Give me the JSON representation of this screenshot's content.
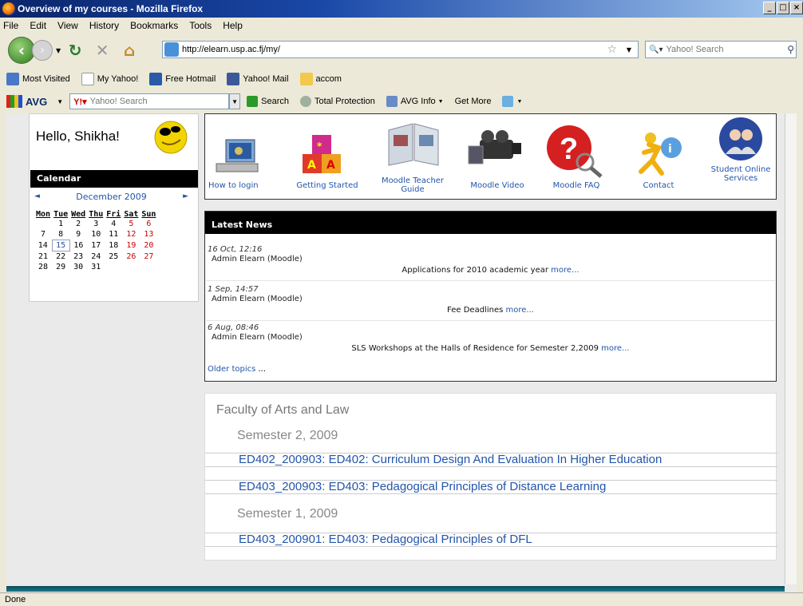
{
  "window": {
    "title": "Overview of my courses - Mozilla Firefox",
    "minimize": "_",
    "restore": "□",
    "close": "×"
  },
  "menu": [
    "File",
    "Edit",
    "View",
    "History",
    "Bookmarks",
    "Tools",
    "Help"
  ],
  "nav": {
    "url": "http://elearn.usp.ac.fj/my/",
    "search_placeholder": "Yahoo! Search"
  },
  "bookmarks": [
    "Most Visited",
    "My Yahoo!",
    "Free Hotmail",
    "Yahoo! Mail",
    "accom"
  ],
  "avg": {
    "logo": "AVG",
    "search_placeholder": "Yahoo! Search",
    "items": [
      "Search",
      "Total Protection",
      "AVG Info",
      "Get More"
    ]
  },
  "greeting": "Hello, Shikha!",
  "calendar": {
    "title": "Calendar",
    "month": "December 2009",
    "prev": "◄",
    "next": "►",
    "days": [
      "Mon",
      "Tue",
      "Wed",
      "Thu",
      "Fri",
      "Sat",
      "Sun"
    ],
    "weeks": [
      [
        "",
        "1",
        "2",
        "3",
        "4",
        "5",
        "6"
      ],
      [
        "7",
        "8",
        "9",
        "10",
        "11",
        "12",
        "13"
      ],
      [
        "14",
        "15",
        "16",
        "17",
        "18",
        "19",
        "20"
      ],
      [
        "21",
        "22",
        "23",
        "24",
        "25",
        "26",
        "27"
      ],
      [
        "28",
        "29",
        "30",
        "31",
        "",
        "",
        ""
      ]
    ]
  },
  "links": [
    {
      "label": "How to login"
    },
    {
      "label": "Getting Started"
    },
    {
      "label": "Moodle Teacher Guide"
    },
    {
      "label": "Moodle Video"
    },
    {
      "label": "Moodle FAQ"
    },
    {
      "label": "Contact"
    },
    {
      "label": "Student Online Services"
    }
  ],
  "news": {
    "title": "Latest News",
    "items": [
      {
        "date": "16 Oct, 12:16",
        "author": "Admin Elearn (Moodle)",
        "subject": "Applications for 2010 academic year",
        "more": "more..."
      },
      {
        "date": "1 Sep, 14:57",
        "author": "Admin Elearn (Moodle)",
        "subject": "Fee Deadlines",
        "more": "more..."
      },
      {
        "date": "6 Aug, 08:46",
        "author": "Admin Elearn (Moodle)",
        "subject": "SLS Workshops at the Halls of Residence for Semester 2,2009",
        "more": "more..."
      }
    ],
    "older": "Older topics",
    "older_suffix": "..."
  },
  "courses": {
    "faculty": "Faculty of Arts and Law",
    "sem2": "Semester 2, 2009",
    "sem1": "Semester 1, 2009",
    "c1": "ED402_200903: ED402: Curriculum Design And Evaluation In Higher Education",
    "c2": "ED403_200903: ED403: Pedagogical Principles of Distance Learning",
    "c3": "ED403_200901: ED403: Pedagogical Principles of DFL"
  },
  "status": "Done"
}
